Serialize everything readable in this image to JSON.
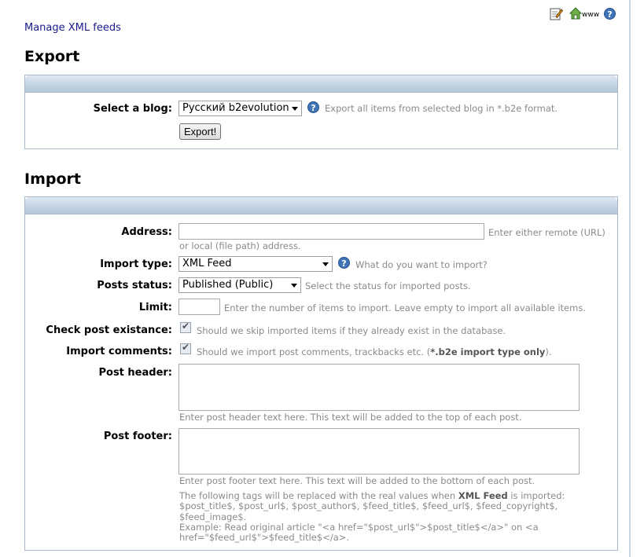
{
  "header": {
    "manage_link": "Manage XML feeds",
    "icons": [
      "edit-icon",
      "home-www-icon",
      "help-icon"
    ],
    "www_label": "www"
  },
  "export": {
    "title": "Export",
    "select_blog_label": "Select a blog:",
    "select_blog_value": "Русский b2evolution",
    "select_blog_note": "Export all items from selected blog in *.b2e format.",
    "export_button": "Export!"
  },
  "import": {
    "title": "Import",
    "address_label": "Address:",
    "address_value": "",
    "address_note_1": "Enter either remote (URL)",
    "address_note_2": "or local (file path) address.",
    "import_type_label": "Import type:",
    "import_type_value": "XML Feed",
    "import_type_note": "What do you want to import?",
    "posts_status_label": "Posts status:",
    "posts_status_value": "Published (Public)",
    "posts_status_note": "Select the status for imported posts.",
    "limit_label": "Limit:",
    "limit_value": "",
    "limit_note": "Enter the number of items to import. Leave empty to import all available items.",
    "check_label": "Check post existance:",
    "check_note": "Should we skip imported items if they already exist in the database.",
    "comments_label": "Import comments:",
    "comments_note_pre": "Should we import post comments, trackbacks etc. (",
    "comments_note_strong": "*.b2e import type only",
    "comments_note_post": ").",
    "post_header_label": "Post header:",
    "post_header_note": "Enter post header text here. This text will be added to the top of each post.",
    "post_footer_label": "Post footer:",
    "post_footer_note": "Enter post footer text here. This text will be added to the bottom of each post.",
    "tags_note_pre": "The following tags will be replaced with the real values when ",
    "tags_note_strong": "XML Feed",
    "tags_note_post": " is imported:",
    "tags_line_2": "$post_title$, $post_url$, $post_author$, $feed_title$, $feed_url$, $feed_copyright$,",
    "tags_line_3": "$feed_image$.",
    "example_line_1": "Example: Read original article \"<a href=\"$post_url$\">$post_title$</a>\" on <a",
    "example_line_2": "href=\"$feed_url$\">$feed_title$</a>."
  }
}
